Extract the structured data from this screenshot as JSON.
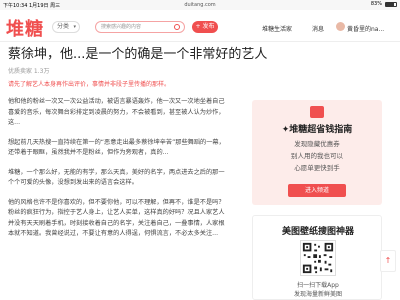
{
  "status_bar": {
    "time_date": "下午10:34  1月19日 周三",
    "url": "duitang.com",
    "battery_percent": "83%"
  },
  "header": {
    "logo": "堆糖",
    "category_label": "分类",
    "search_placeholder": "搜索感兴趣的内容",
    "publish_label": "+ 发布",
    "nav_life": "堆糖生活家",
    "nav_messages": "消息",
    "username": "黄昏里的na..."
  },
  "article": {
    "title": "蔡徐坤，他...是一个的确是一个非常好的艺人",
    "meta": "优质卖家 1.3万",
    "notice": "请先了解艺人本身再作出评价，事情并非段子里传播的那样。",
    "paragraphs": [
      "他和他的粉丝一次又一次公益活动，被语言暴语轰炸，他一次又一次地坐着自己喜爱的音乐，每次舞台彩排定到凌晨的努力，不会被看到，甚至被人认为炒作，这...",
      "想起前几天热搜一直持续在第一的“恶意走出最多蔡徐坤辛苦”那些舞蹈的一幕，还带着于眼眶，虽然我并不是粉丝，但作为旁观者，真的...",
      "堆糖，一个那么好，无能的有学，那么天真，美好的名字，两点进去之后的那一个个可爱的头像，没想到发出来的语言会这样。",
      "他的风格也许不是你喜欢的，但不要你他，可以不理解，但再不，谁是不是吗？粉丝的疯狂行为，指控于艺人身上，让艺人买单，这样真的好吗？况且人家艺人并没有天天刷着手机，时刻接收着自己的名字，关注着自己，一叠事情，人家根本就不知道。我曾经说过，不要让有意的人得逞，何惧流言，不必太多关注..."
    ],
    "paragraph2_link": "恶意走出最多蔡徐坤辛苦",
    "paragraph3_red": "堆糖，一个那么好，无能的有学，那么天真，美好的名字",
    "paragraph4_red": "可以不理解，但再不，谁是不是吗？"
  },
  "sidebar": {
    "card1_title": "✦堆糖超省钱指南",
    "card1_line1": "发现隐藏优惠券",
    "card1_line2": "别人用的我也可以",
    "card1_line3": "心愿单更快到手",
    "card1_button": "进入频道",
    "card2_title": "美图壁纸搜图神器",
    "card2_line1": "扫一扫下载App",
    "card2_line2": "发现海量新鲜美图"
  },
  "scroll_top_label": "↑"
}
